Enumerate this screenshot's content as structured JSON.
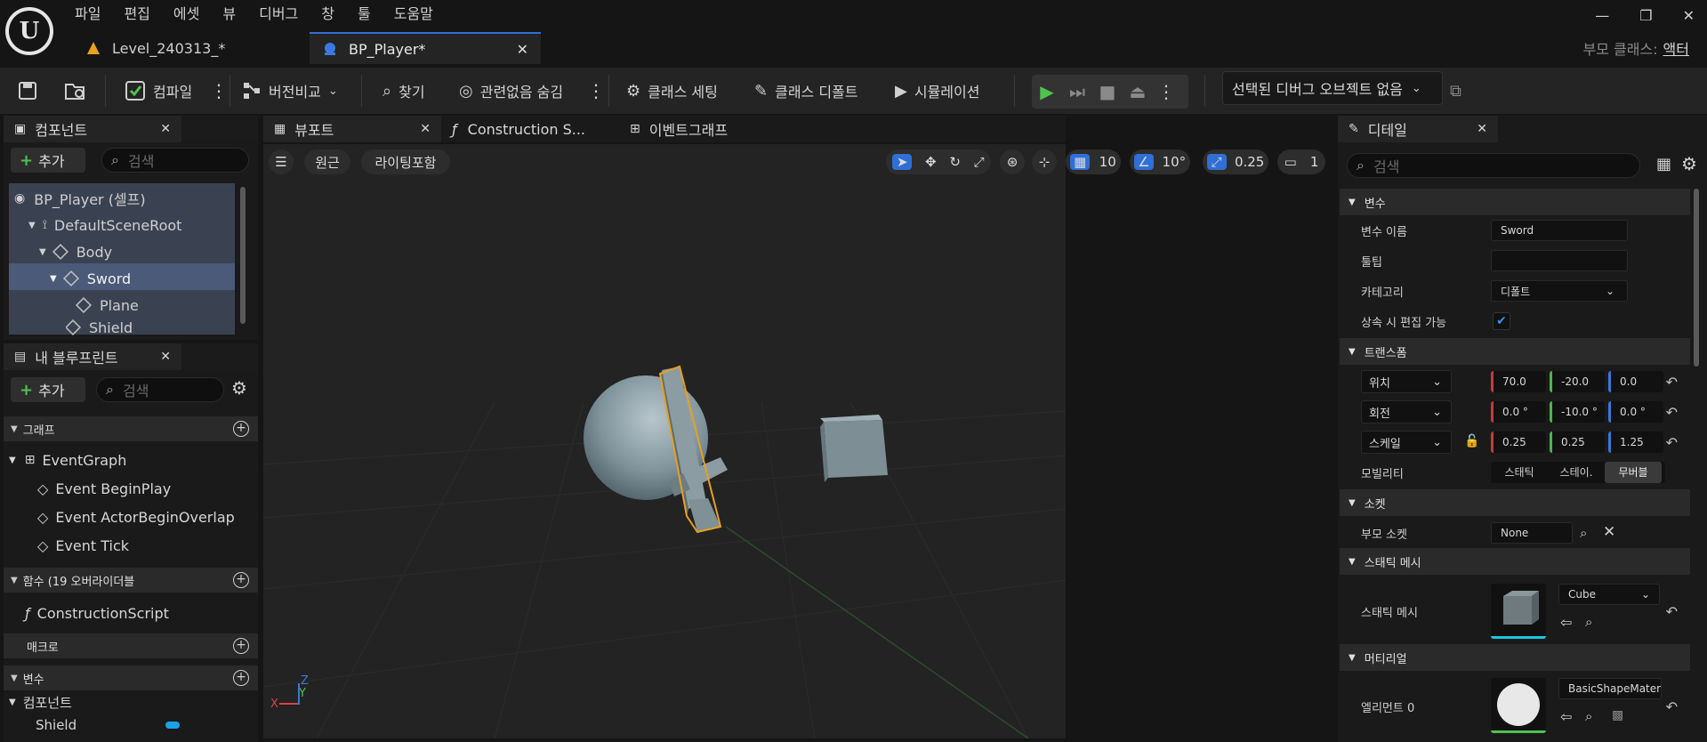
{
  "menu": [
    "파일",
    "편집",
    "에셋",
    "뷰",
    "디버그",
    "창",
    "툴",
    "도움말"
  ],
  "tabs": {
    "level": "Level_240313_*",
    "blueprint": "BP_Player*"
  },
  "parent_class": {
    "label": "부모 클래스:",
    "value": "액터"
  },
  "toolbar": {
    "compile": "컴파일",
    "diff": "버전비교",
    "find": "찾기",
    "hide_unrelated": "관련없음 숨김",
    "class_settings": "클래스 세팅",
    "class_defaults": "클래스 디폴트",
    "simulation": "시뮬레이션",
    "debug_object": "선택된 디버그 오브젝트 없음"
  },
  "components_panel": {
    "title": "컴포넌트",
    "add_label": "추가",
    "search_placeholder": "검색",
    "tree": [
      "BP_Player (셀프)",
      "DefaultSceneRoot",
      "Body",
      "Sword",
      "Plane",
      "Shield"
    ]
  },
  "blueprint_panel": {
    "title": "내 블루프린트",
    "add_label": "추가",
    "search_placeholder": "검색",
    "graph_section": "그래프",
    "event_graph": "EventGraph",
    "events": [
      "Event BeginPlay",
      "Event ActorBeginOverlap",
      "Event Tick"
    ],
    "functions_section": "함수 (19 오버라이더블",
    "construction_script": "ConstructionScript",
    "macros_section": "매크로",
    "variables_section": "변수",
    "components_category": "컴포넌트",
    "component_var": "Shield"
  },
  "viewport_tabs": {
    "viewport": "뷰포트",
    "construction": "Construction S...",
    "event_graph": "이벤트그래프"
  },
  "viewport_toolbar": {
    "perspective": "원근",
    "lighting": "라이팅포함",
    "grid_snap": "10",
    "rotation_snap": "10°",
    "scale_snap": "0.25",
    "camera_speed": "1"
  },
  "details": {
    "title": "디테일",
    "search_placeholder": "검색",
    "variable_section": "변수",
    "variable_name_label": "변수 이름",
    "variable_name": "Sword",
    "tooltip_label": "툴팁",
    "tooltip_value": "",
    "category_label": "카테고리",
    "category_value": "디폴트",
    "editable_label": "상속 시 편집 가능",
    "transform_section": "트랜스폼",
    "location_label": "위치",
    "location": [
      "70.0",
      "-20.0",
      "0.0"
    ],
    "rotation_label": "회전",
    "rotation": [
      "0.0 °",
      "-10.0 °",
      "0.0 °"
    ],
    "scale_label": "스케일",
    "scale": [
      "0.25",
      "0.25",
      "1.25"
    ],
    "mobility_label": "모빌리티",
    "mobility_options": [
      "스태틱",
      "스테이.",
      "무버블"
    ],
    "socket_section": "소켓",
    "parent_socket_label": "부모 소켓",
    "parent_socket_value": "None",
    "static_mesh_section": "스태틱 메시",
    "static_mesh_label": "스태틱 메시",
    "static_mesh_value": "Cube",
    "material_section": "머티리얼",
    "element0_label": "엘리먼트 0",
    "element0_value": "BasicShapeMateri"
  },
  "colors": {
    "accent_blue": "#2f6fd6",
    "selection_orange": "#e8a020",
    "play_green": "#4fc24f"
  }
}
